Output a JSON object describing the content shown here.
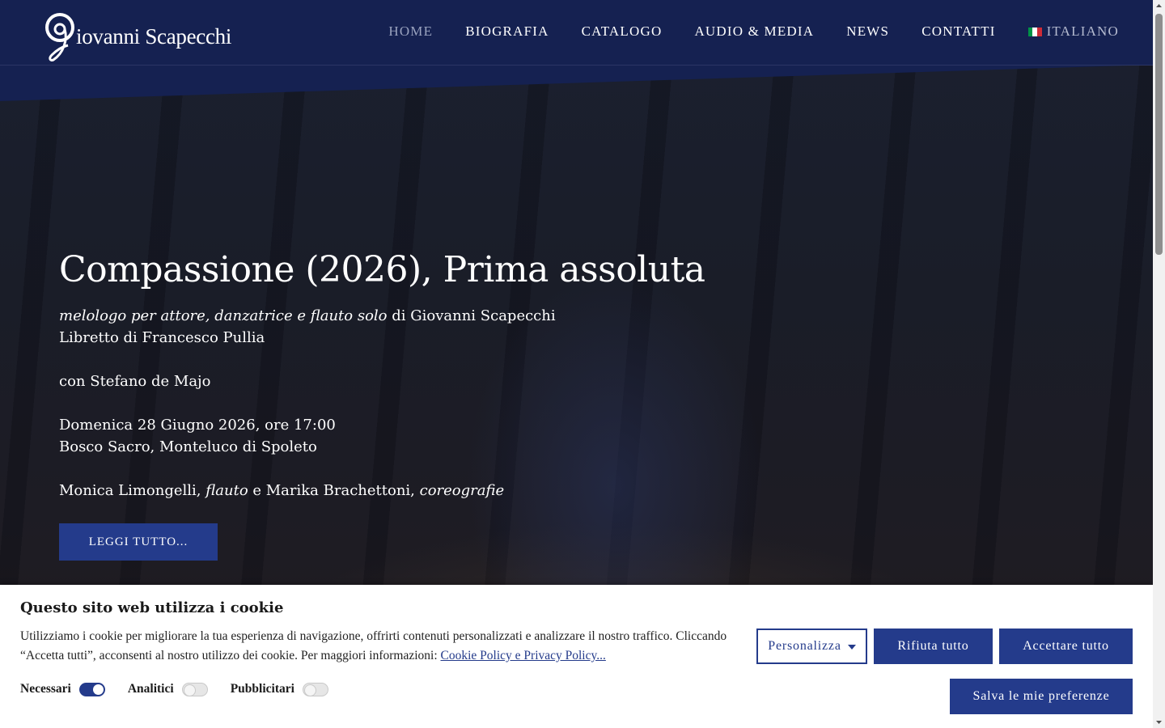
{
  "brand": {
    "name": "iovanni Scapecchi",
    "monogram": "G"
  },
  "nav": {
    "items": [
      {
        "label": "HOME",
        "active": true
      },
      {
        "label": "BIOGRAFIA"
      },
      {
        "label": "CATALOGO"
      },
      {
        "label": "AUDIO & MEDIA"
      },
      {
        "label": "NEWS"
      },
      {
        "label": "CONTATTI"
      }
    ],
    "language": {
      "label": "ITALIANO",
      "icon": "italy-flag-icon"
    }
  },
  "hero": {
    "title": "Compassione (2026), Prima assoluta",
    "subtitle_italic": "melologo per attore, danzatrice e flauto solo",
    "subtitle_rest": " di Giovanni Scapecchi",
    "libretto": "Libretto di Francesco Pullia",
    "with": "con Stefano de Majo",
    "date": "Domenica 28 Giugno 2026, ore 17:00",
    "venue": "Bosco Sacro, Monteluco di Spoleto",
    "performer1": "Monica Limongelli, ",
    "performer1_role": "flauto",
    "performer_join": " e Marika Brachettoni, ",
    "performer2_role": "coreografie",
    "read_more": "LEGGI TUTTO..."
  },
  "cookie": {
    "title": "Questo sito web utilizza i cookie",
    "text": "Utilizziamo i cookie per migliorare la tua esperienza di navigazione, offrirti contenuti personalizzati e analizzare il nostro traffico. Cliccando “Accetta tutti”, acconsenti al nostro utilizzo dei cookie. Per maggiori informazioni: ",
    "link": "Cookie Policy e Privacy Policy...",
    "toggles": [
      {
        "label": "Necessari",
        "on": true
      },
      {
        "label": "Analitici",
        "on": false
      },
      {
        "label": "Pubblicitari",
        "on": false
      }
    ],
    "customize": "Personalizza",
    "reject": "Rifiuta tutto",
    "accept": "Accettare tutto",
    "save": "Salva le mie preferenze"
  },
  "colors": {
    "header_bg": "#152151",
    "accent": "#243b8b",
    "active_nav": "#9aa3bf"
  }
}
